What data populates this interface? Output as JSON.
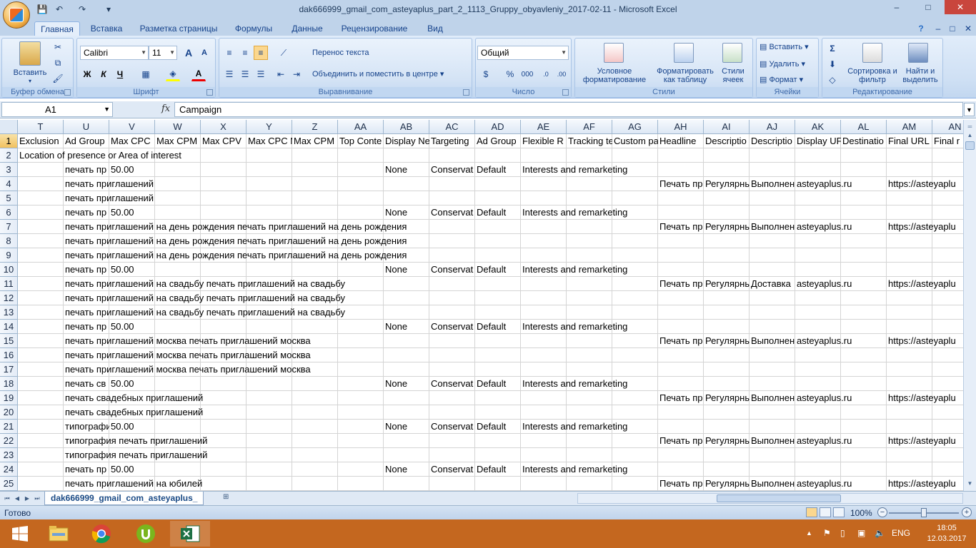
{
  "window": {
    "title": "dak666999_gmail_com_asteyaplus_part_2_1113_Gruppy_obyavleniy_2017-02-11 - Microsoft Excel",
    "controls": {
      "help": "?",
      "minimize": "–",
      "maximize": "□",
      "close": "✕"
    }
  },
  "qat": {
    "save": "💾",
    "undo": "↶",
    "redo": "↷",
    "customize": "▾"
  },
  "tabs": [
    "Главная",
    "Вставка",
    "Разметка страницы",
    "Формулы",
    "Данные",
    "Рецензирование",
    "Вид"
  ],
  "ribbon": {
    "clipboard": {
      "label": "Буфер обмена",
      "paste": "Вставить"
    },
    "font": {
      "label": "Шрифт",
      "name": "Calibri",
      "size": "11",
      "bold": "Ж",
      "italic": "К",
      "underline": "Ч",
      "grow": "A",
      "shrink": "A"
    },
    "alignment": {
      "label": "Выравнивание",
      "wrap": "Перенос текста",
      "merge": "Объединить и поместить в центре"
    },
    "number": {
      "label": "Число",
      "format": "Общий",
      "percent": "%",
      "thousands": "000"
    },
    "styles": {
      "label": "Стили",
      "conditional": "Условное форматирование",
      "table": "Форматировать как таблицу",
      "cell": "Стили ячеек"
    },
    "cells": {
      "label": "Ячейки",
      "insert": "Вставить",
      "delete": "Удалить",
      "format": "Формат"
    },
    "editing": {
      "label": "Редактирование",
      "sort": "Сортировка и фильтр",
      "find": "Найти и выделить"
    }
  },
  "formula_bar": {
    "name_box": "A1",
    "fx": "fx",
    "formula": "Campaign"
  },
  "columns": [
    "T",
    "U",
    "V",
    "W",
    "X",
    "Y",
    "Z",
    "AA",
    "AB",
    "AC",
    "AD",
    "AE",
    "AF",
    "AG",
    "AH",
    "AI",
    "AJ",
    "AK",
    "AL",
    "AM",
    "AN"
  ],
  "rows": [
    {
      "n": "1",
      "cells": [
        "Exclusion",
        "Ad Group",
        "Max CPC",
        "Max CPM",
        "Max CPV",
        "Max CPC M",
        "Max CPM",
        "Top Conte",
        "Display Ne",
        "Targeting",
        "Ad Group",
        "Flexible R",
        "Tracking te",
        "Custom pa",
        "Headline",
        "Descriptio",
        "Descriptio",
        "Display UF",
        "Destinatio",
        "Final URL",
        "Final r"
      ]
    },
    {
      "n": "2",
      "cells": [
        "Location of presence or Area of interest",
        "",
        "",
        "",
        "",
        "",
        "",
        "",
        "",
        "",
        "",
        "",
        "",
        "",
        "",
        "",
        "",
        "",
        "",
        "",
        ""
      ]
    },
    {
      "n": "3",
      "cells": [
        "",
        "печать пр",
        "50.00",
        "",
        "",
        "",
        "",
        "",
        "None",
        "Conservat",
        "Default",
        "Interests and remarketing",
        "",
        "",
        "",
        "",
        "",
        "",
        "",
        "",
        ""
      ]
    },
    {
      "n": "4",
      "cells": [
        "",
        "печать приглашений",
        "",
        "",
        "",
        "",
        "",
        "",
        "",
        "",
        "",
        "",
        "",
        "",
        "Печать пр",
        "Регулярны",
        "Выполнен",
        "asteyaplus.ru",
        "",
        "https://asteyaplu",
        ""
      ]
    },
    {
      "n": "5",
      "cells": [
        "",
        "печать приглашений",
        "",
        "",
        "",
        "",
        "",
        "",
        "",
        "",
        "",
        "",
        "",
        "",
        "",
        "",
        "",
        "",
        "",
        "",
        ""
      ]
    },
    {
      "n": "6",
      "cells": [
        "",
        "печать пр",
        "50.00",
        "",
        "",
        "",
        "",
        "",
        "None",
        "Conservat",
        "Default",
        "Interests and remarketing",
        "",
        "",
        "",
        "",
        "",
        "",
        "",
        "",
        ""
      ]
    },
    {
      "n": "7",
      "cells": [
        "",
        "печать приглашений на день рождения печать приглашений на день рождения",
        "",
        "",
        "",
        "",
        "",
        "",
        "",
        "",
        "",
        "",
        "",
        "",
        "Печать пр",
        "Регулярны",
        "Выполнен",
        "asteyaplus.ru",
        "",
        "https://asteyaplu",
        ""
      ]
    },
    {
      "n": "8",
      "cells": [
        "",
        "печать приглашений на день рождения печать приглашений на день рождения",
        "",
        "",
        "",
        "",
        "",
        "",
        "",
        "",
        "",
        "",
        "",
        "",
        "",
        "",
        "",
        "",
        "",
        "",
        ""
      ]
    },
    {
      "n": "9",
      "cells": [
        "",
        "печать приглашений на день рождения печать приглашений на день рождения",
        "",
        "",
        "",
        "",
        "",
        "",
        "",
        "",
        "",
        "",
        "",
        "",
        "",
        "",
        "",
        "",
        "",
        "",
        ""
      ]
    },
    {
      "n": "10",
      "cells": [
        "",
        "печать пр",
        "50.00",
        "",
        "",
        "",
        "",
        "",
        "None",
        "Conservat",
        "Default",
        "Interests and remarketing",
        "",
        "",
        "",
        "",
        "",
        "",
        "",
        "",
        ""
      ]
    },
    {
      "n": "11",
      "cells": [
        "",
        "печать приглашений на свадьбу печать приглашений на свадьбу",
        "",
        "",
        "",
        "",
        "",
        "",
        "",
        "",
        "",
        "",
        "",
        "",
        "Печать пр",
        "Регулярны",
        "Доставка",
        "asteyaplus.ru",
        "",
        "https://asteyaplu",
        ""
      ]
    },
    {
      "n": "12",
      "cells": [
        "",
        "печать приглашений на свадьбу печать приглашений на свадьбу",
        "",
        "",
        "",
        "",
        "",
        "",
        "",
        "",
        "",
        "",
        "",
        "",
        "",
        "",
        "",
        "",
        "",
        "",
        ""
      ]
    },
    {
      "n": "13",
      "cells": [
        "",
        "печать приглашений на свадьбу печать приглашений на свадьбу",
        "",
        "",
        "",
        "",
        "",
        "",
        "",
        "",
        "",
        "",
        "",
        "",
        "",
        "",
        "",
        "",
        "",
        "",
        ""
      ]
    },
    {
      "n": "14",
      "cells": [
        "",
        "печать пр",
        "50.00",
        "",
        "",
        "",
        "",
        "",
        "None",
        "Conservat",
        "Default",
        "Interests and remarketing",
        "",
        "",
        "",
        "",
        "",
        "",
        "",
        "",
        ""
      ]
    },
    {
      "n": "15",
      "cells": [
        "",
        "печать приглашений москва печать приглашений москва",
        "",
        "",
        "",
        "",
        "",
        "",
        "",
        "",
        "",
        "",
        "",
        "",
        "Печать пр",
        "Регулярны",
        "Выполнен",
        "asteyaplus.ru",
        "",
        "https://asteyaplu",
        ""
      ]
    },
    {
      "n": "16",
      "cells": [
        "",
        "печать приглашений москва печать приглашений москва",
        "",
        "",
        "",
        "",
        "",
        "",
        "",
        "",
        "",
        "",
        "",
        "",
        "",
        "",
        "",
        "",
        "",
        "",
        ""
      ]
    },
    {
      "n": "17",
      "cells": [
        "",
        "печать приглашений москва печать приглашений москва",
        "",
        "",
        "",
        "",
        "",
        "",
        "",
        "",
        "",
        "",
        "",
        "",
        "",
        "",
        "",
        "",
        "",
        "",
        ""
      ]
    },
    {
      "n": "18",
      "cells": [
        "",
        "печать св",
        "50.00",
        "",
        "",
        "",
        "",
        "",
        "None",
        "Conservat",
        "Default",
        "Interests and remarketing",
        "",
        "",
        "",
        "",
        "",
        "",
        "",
        "",
        ""
      ]
    },
    {
      "n": "19",
      "cells": [
        "",
        "печать свадебных приглашений",
        "",
        "",
        "",
        "",
        "",
        "",
        "",
        "",
        "",
        "",
        "",
        "",
        "Печать пр",
        "Регулярны",
        "Выполнен",
        "asteyaplus.ru",
        "",
        "https://asteyaplu",
        ""
      ]
    },
    {
      "n": "20",
      "cells": [
        "",
        "печать свадебных приглашений",
        "",
        "",
        "",
        "",
        "",
        "",
        "",
        "",
        "",
        "",
        "",
        "",
        "",
        "",
        "",
        "",
        "",
        "",
        ""
      ]
    },
    {
      "n": "21",
      "cells": [
        "",
        "типографи",
        "50.00",
        "",
        "",
        "",
        "",
        "",
        "None",
        "Conservat",
        "Default",
        "Interests and remarketing",
        "",
        "",
        "",
        "",
        "",
        "",
        "",
        "",
        ""
      ]
    },
    {
      "n": "22",
      "cells": [
        "",
        "типография печать приглашений",
        "",
        "",
        "",
        "",
        "",
        "",
        "",
        "",
        "",
        "",
        "",
        "",
        "Печать пр",
        "Регулярны",
        "Выполнен",
        "asteyaplus.ru",
        "",
        "https://asteyaplu",
        ""
      ]
    },
    {
      "n": "23",
      "cells": [
        "",
        "типография печать приглашений",
        "",
        "",
        "",
        "",
        "",
        "",
        "",
        "",
        "",
        "",
        "",
        "",
        "",
        "",
        "",
        "",
        "",
        "",
        ""
      ]
    },
    {
      "n": "24",
      "cells": [
        "",
        "печать пр",
        "50.00",
        "",
        "",
        "",
        "",
        "",
        "None",
        "Conservat",
        "Default",
        "Interests and remarketing",
        "",
        "",
        "",
        "",
        "",
        "",
        "",
        "",
        ""
      ]
    },
    {
      "n": "25",
      "cells": [
        "",
        "печать приглашений на юбилей",
        "",
        "",
        "",
        "",
        "",
        "",
        "",
        "",
        "",
        "",
        "",
        "",
        "Печать пр",
        "Регулярны",
        "Выполнен",
        "asteyaplus.ru",
        "",
        "https://asteyaplu",
        ""
      ]
    }
  ],
  "sheet_tab": "dak666999_gmail_com_asteyaplus_",
  "status": {
    "text": "Готово",
    "zoom": "100%",
    "zoom_minus": "−",
    "zoom_plus": "+"
  },
  "taskbar": {
    "lang": "ENG",
    "time": "18:05",
    "date": "12.03.2017"
  },
  "colors": {
    "title_bg": "#bfd3ea",
    "ribbon_bg": "#cfe0f4",
    "taskbar": "#c4671f",
    "selected_header": "#f1c15f"
  }
}
